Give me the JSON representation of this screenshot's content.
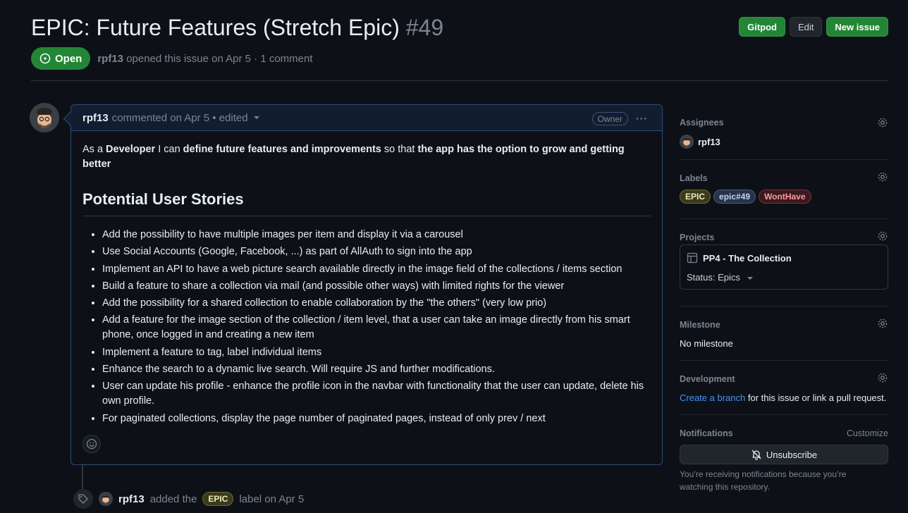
{
  "issue": {
    "title": "EPIC: Future Features (Stretch Epic)",
    "number": "#49",
    "state": "Open",
    "author": "rpf13",
    "meta_rest": "opened this issue on Apr 5 · 1 comment"
  },
  "header_actions": {
    "gitpod": "Gitpod",
    "edit": "Edit",
    "new_issue": "New issue"
  },
  "comment": {
    "author": "rpf13",
    "meta": "commented on Apr 5 • edited",
    "badge": "Owner",
    "menu": "···",
    "intro": {
      "p1": "As a ",
      "b1": "Developer",
      "p2": " I can ",
      "b2": "define future features and improvements",
      "p3": " so that ",
      "b3": "the app has the option to grow and getting better"
    },
    "heading": "Potential User Stories",
    "stories": [
      "Add the possibility to have multiple images per item and display it via a carousel",
      "Use Social Accounts (Google, Facebook, ...) as part of AllAuth to sign into the app",
      "Implement an API to have a web picture search available directly in the image field of the collections / items section",
      "Build a feature to share a collection via mail (and possible other ways) with limited rights for the viewer",
      "Add the possibility for a shared collection to enable collaboration by the \"the others\" (very low prio)",
      "Add a feature for the image section of the collection / item level, that a user can take an image directly from his smart phone, once logged in and creating a new item",
      "Implement a feature to tag, label individual items",
      "Enhance the search to a dynamic live search. Will require JS and further modifications.",
      "User can update his profile - enhance the profile icon in the navbar with functionality that the user can update, delete his own profile.",
      "For paginated collections, display the page number of paginated pages, instead of only prev / next"
    ]
  },
  "event": {
    "actor": "rpf13",
    "text1": "added the",
    "label": "EPIC",
    "text2": "label on Apr 5"
  },
  "sidebar": {
    "assignees": {
      "title": "Assignees",
      "user": "rpf13"
    },
    "labels": {
      "title": "Labels",
      "items": [
        "EPIC",
        "epic#49",
        "WontHave"
      ]
    },
    "projects": {
      "title": "Projects",
      "name": "PP4 - The Collection",
      "status": "Status: Epics"
    },
    "milestone": {
      "title": "Milestone",
      "value": "No milestone"
    },
    "development": {
      "title": "Development",
      "link": "Create a branch",
      "rest": " for this issue or link a pull request."
    },
    "notifications": {
      "title": "Notifications",
      "customize": "Customize",
      "button": "Unsubscribe",
      "note": "You’re receiving notifications because you’re watching this repository."
    }
  },
  "colors": {
    "accent_green": "#238636",
    "link_blue": "#4493f8",
    "background": "#0d1117"
  }
}
